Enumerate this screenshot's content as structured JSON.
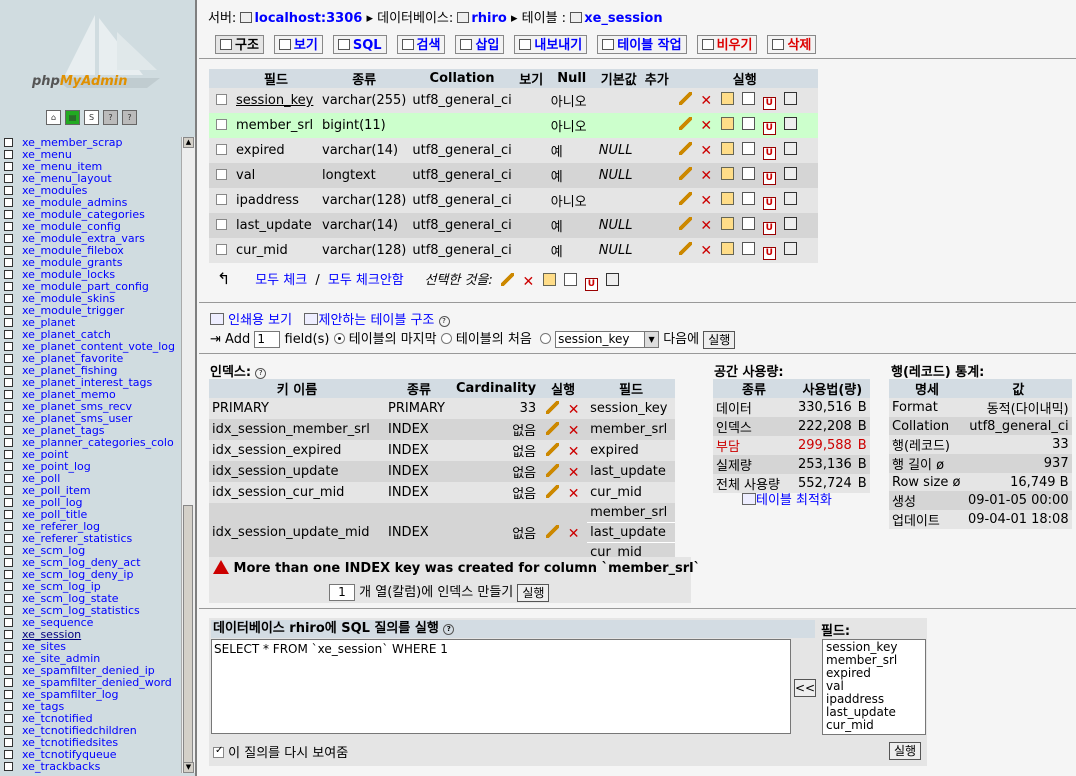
{
  "nav": {
    "logo_php": "php",
    "logo_myadmin": "MyAdmin",
    "icons": [
      "home-icon",
      "sql-query-window-icon",
      "sql-icon",
      "docs-icon",
      "help-icon"
    ],
    "tables": [
      "xe_member_scrap",
      "xe_menu",
      "xe_menu_item",
      "xe_menu_layout",
      "xe_modules",
      "xe_module_admins",
      "xe_module_categories",
      "xe_module_config",
      "xe_module_extra_vars",
      "xe_module_filebox",
      "xe_module_grants",
      "xe_module_locks",
      "xe_module_part_config",
      "xe_module_skins",
      "xe_module_trigger",
      "xe_planet",
      "xe_planet_catch",
      "xe_planet_content_vote_log",
      "xe_planet_favorite",
      "xe_planet_fishing",
      "xe_planet_interest_tags",
      "xe_planet_memo",
      "xe_planet_sms_recv",
      "xe_planet_sms_user",
      "xe_planet_tags",
      "xe_planner_categories_colo",
      "xe_point",
      "xe_point_log",
      "xe_poll",
      "xe_poll_item",
      "xe_poll_log",
      "xe_poll_title",
      "xe_referer_log",
      "xe_referer_statistics",
      "xe_scm_log",
      "xe_scm_log_deny_act",
      "xe_scm_log_deny_ip",
      "xe_scm_log_ip",
      "xe_scm_log_state",
      "xe_scm_log_statistics",
      "xe_sequence",
      "xe_session",
      "xe_sites",
      "xe_site_admin",
      "xe_spamfilter_denied_ip",
      "xe_spamfilter_denied_word",
      "xe_spamfilter_log",
      "xe_tags",
      "xe_tcnotified",
      "xe_tcnotifiedchildren",
      "xe_tcnotifiedsites",
      "xe_tcnotifyqueue",
      "xe_trackbacks"
    ],
    "current_table": "xe_session"
  },
  "breadcrumb": {
    "server_label": "서버:",
    "server": "localhost:3306",
    "db_label": "데이터베이스:",
    "db": "rhiro",
    "table_label": "테이블 :",
    "table": "xe_session"
  },
  "tabs": [
    {
      "label": "구조",
      "icon": "structure-icon"
    },
    {
      "label": "보기",
      "icon": "browse-icon"
    },
    {
      "label": "SQL",
      "icon": "sql-icon"
    },
    {
      "label": "검색",
      "icon": "search-icon"
    },
    {
      "label": "삽입",
      "icon": "insert-icon"
    },
    {
      "label": "내보내기",
      "icon": "export-icon"
    },
    {
      "label": "테이블 작업",
      "icon": "operations-icon"
    },
    {
      "label": "비우기",
      "icon": "empty-icon"
    },
    {
      "label": "삭제",
      "icon": "drop-icon"
    }
  ],
  "structure": {
    "headers": [
      "필드",
      "종류",
      "Collation",
      "보기",
      "Null",
      "기본값",
      "추가",
      "실행"
    ],
    "rows": [
      {
        "field": "session_key",
        "type": "varchar(255)",
        "collation": "utf8_general_ci",
        "attr": "",
        "null": "아니오",
        "default": "",
        "extra": ""
      },
      {
        "field": "member_srl",
        "type": "bigint(11)",
        "collation": "",
        "attr": "",
        "null": "아니오",
        "default": "",
        "extra": ""
      },
      {
        "field": "expired",
        "type": "varchar(14)",
        "collation": "utf8_general_ci",
        "attr": "",
        "null": "예",
        "default": "NULL",
        "extra": ""
      },
      {
        "field": "val",
        "type": "longtext",
        "collation": "utf8_general_ci",
        "attr": "",
        "null": "예",
        "default": "NULL",
        "extra": ""
      },
      {
        "field": "ipaddress",
        "type": "varchar(128)",
        "collation": "utf8_general_ci",
        "attr": "",
        "null": "아니오",
        "default": "",
        "extra": ""
      },
      {
        "field": "last_update",
        "type": "varchar(14)",
        "collation": "utf8_general_ci",
        "attr": "",
        "null": "예",
        "default": "NULL",
        "extra": ""
      },
      {
        "field": "cur_mid",
        "type": "varchar(128)",
        "collation": "utf8_general_ci",
        "attr": "",
        "null": "예",
        "default": "NULL",
        "extra": ""
      }
    ],
    "check_all": "모두 체크",
    "divider": "/",
    "uncheck_all": "모두 체크안함",
    "with_selected": "선택한 것을:"
  },
  "links": {
    "print_view": "인쇄용 보기",
    "propose_structure": "제안하는 테이블 구조"
  },
  "add_field": {
    "add_label": "Add",
    "count": "1",
    "fields_label": "field(s)",
    "at_end": "테이블의 마지막",
    "at_begin": "테이블의 처음",
    "after_field": "session_key",
    "after_label": "다음에",
    "go": "실행"
  },
  "indexes": {
    "title": "인덱스:",
    "headers": [
      "키 이름",
      "종류",
      "Cardinality",
      "실행",
      "필드"
    ],
    "rows": [
      {
        "name": "PRIMARY",
        "type": "PRIMARY",
        "cardinality": "33",
        "fields": [
          "session_key"
        ]
      },
      {
        "name": "idx_session_member_srl",
        "type": "INDEX",
        "cardinality": "없음",
        "fields": [
          "member_srl"
        ]
      },
      {
        "name": "idx_session_expired",
        "type": "INDEX",
        "cardinality": "없음",
        "fields": [
          "expired"
        ]
      },
      {
        "name": "idx_session_update",
        "type": "INDEX",
        "cardinality": "없음",
        "fields": [
          "last_update"
        ]
      },
      {
        "name": "idx_session_cur_mid",
        "type": "INDEX",
        "cardinality": "없음",
        "fields": [
          "cur_mid"
        ]
      },
      {
        "name": "idx_session_update_mid",
        "type": "INDEX",
        "cardinality": "없음",
        "fields": [
          "member_srl",
          "last_update",
          "cur_mid"
        ]
      }
    ],
    "warning": "More than one INDEX key was created for column `member_srl`",
    "create_count": "1",
    "create_label": "개 열(칼럼)에 인덱스 만들기",
    "create_go": "실행"
  },
  "space": {
    "title": "공간 사용량:",
    "headers": [
      "종류",
      "사용법(량)"
    ],
    "rows": [
      {
        "label": "데이터",
        "value": "330,516",
        "unit": "B",
        "warn": false
      },
      {
        "label": "인덱스",
        "value": "222,208",
        "unit": "B",
        "warn": false
      },
      {
        "label": "부담",
        "value": "299,588",
        "unit": "B",
        "warn": true
      },
      {
        "label": "실제량",
        "value": "253,136",
        "unit": "B",
        "warn": false
      },
      {
        "label": "전체 사용량",
        "value": "552,724",
        "unit": "B",
        "warn": false
      }
    ],
    "optimize": "테이블 최적화"
  },
  "stats": {
    "title": "행(레코드) 통계:",
    "headers": [
      "명세",
      "값"
    ],
    "rows": [
      {
        "label": "Format",
        "value": "동적(다이내믹)"
      },
      {
        "label": "Collation",
        "value": "utf8_general_ci"
      },
      {
        "label": "행(레코드)",
        "value": "33"
      },
      {
        "label": "행 길이 ø",
        "value": "937"
      },
      {
        "label": "Row size ø",
        "value": "16,749 B"
      },
      {
        "label": "생성",
        "value": "09-01-05 00:00"
      },
      {
        "label": "업데이트",
        "value": "09-04-01 18:08"
      }
    ]
  },
  "sql": {
    "title": "데이터베이스 rhiro에 SQL 질의를 실행",
    "query": "SELECT * FROM `xe_session` WHERE 1",
    "fields_title": "필드:",
    "fields": [
      "session_key",
      "member_srl",
      "expired",
      "val",
      "ipaddress",
      "last_update",
      "cur_mid"
    ],
    "insert_btn": "<<",
    "show_again": "이 질의를 다시 보여줌",
    "go": "실행"
  }
}
